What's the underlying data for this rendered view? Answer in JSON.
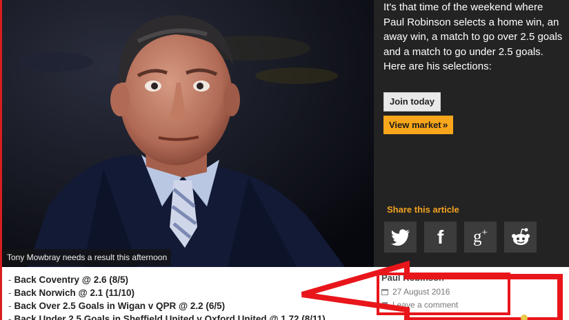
{
  "hero": {
    "caption": "Tony Mowbray needs a result this afternoon"
  },
  "panel": {
    "intro_text": "It's that time of the weekend where Paul Robinson selects a home win, an away win, a match to go over 2.5 goals and a match to go under 2.5 goals. Here are his selections:",
    "join_label": "Join today",
    "market_label": "View market",
    "share_title": "Share this article",
    "share_icons": [
      "twitter-icon",
      "facebook-icon",
      "google-plus-icon",
      "reddit-icon"
    ],
    "accent_color": "#f8a61b"
  },
  "tips": [
    "Back Coventry @ 2.6 (8/5)",
    "Back Norwich @ 2.1 (11/10)",
    "Back Over 2.5 Goals in Wigan v QPR @ 2.2 (6/5)",
    "Back Under 2.5 Goals in Sheffield United v Oxford United @ 1.72 (8/11)"
  ],
  "meta": {
    "author": "Paul Robinson",
    "date": "27 August 2016",
    "comment_label": "Leave a comment"
  },
  "annotation_color": "#e8161b"
}
